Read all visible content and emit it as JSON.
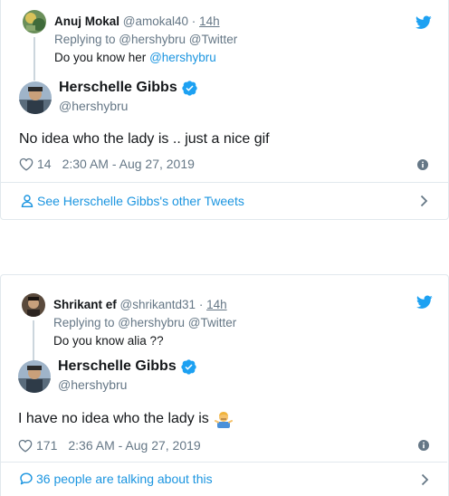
{
  "colors": {
    "accent": "#1b95e0",
    "muted": "#657786",
    "border": "#e1e8ed",
    "text": "#14171a"
  },
  "tweets": [
    {
      "reply": {
        "name": "Anuj Mokal",
        "handle": "@amokal40",
        "separator": "·",
        "time": "14h",
        "replying_label": "Replying to @hershybru @Twitter",
        "text_plain": "Do you know her ",
        "text_mention": "@hershybru",
        "avatar_icon": "user-avatar-icon"
      },
      "main": {
        "name": "Herschelle Gibbs",
        "handle": "@hershybru",
        "text": "No idea who the lady is .. just a nice gif",
        "likes": "14",
        "timestamp": "2:30 AM - Aug 27, 2019"
      },
      "footer": {
        "label": "See Herschelle Gibbs's other Tweets",
        "icon": "person-icon"
      }
    },
    {
      "reply": {
        "name": "Shrikant ef",
        "handle": "@shrikantd31",
        "separator": "·",
        "time": "14h",
        "replying_label": "Replying to @hershybru @Twitter",
        "text_plain": "Do you know alia ??",
        "text_mention": "",
        "avatar_icon": "user-avatar-icon"
      },
      "main": {
        "name": "Herschelle Gibbs",
        "handle": "@hershybru",
        "text": "I have no idea who the lady is",
        "emoji": "person-shrugging-emoji",
        "likes": "171",
        "timestamp": "2:36 AM - Aug 27, 2019"
      },
      "footer": {
        "label": "36 people are talking about this",
        "icon": "speech-bubble-icon"
      }
    }
  ]
}
